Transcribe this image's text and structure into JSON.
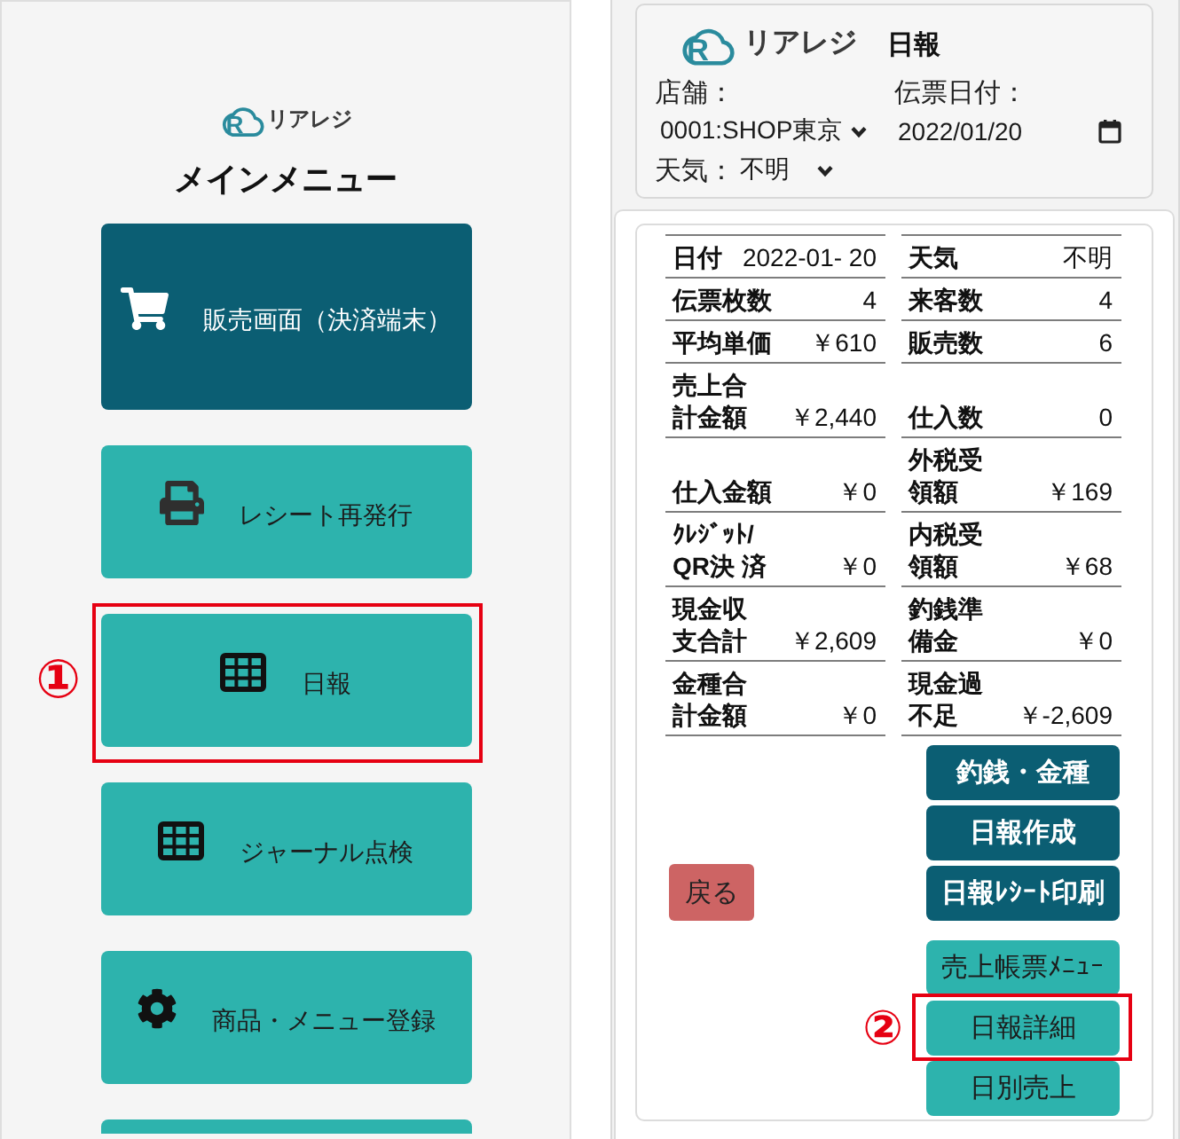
{
  "main_menu": {
    "logo": {
      "mark": "R",
      "name": "リアレジ"
    },
    "title": "メインメニュー",
    "items": [
      {
        "label": "販売画面（決済端末）",
        "kind": "primary",
        "highlighted": false
      },
      {
        "label": "レシート再発行",
        "kind": "secondary",
        "highlighted": false
      },
      {
        "label": "日報",
        "kind": "secondary",
        "highlighted": true,
        "callout": "①"
      },
      {
        "label": "ジャーナル点検",
        "kind": "secondary",
        "highlighted": false
      },
      {
        "label": "商品・メニュー登録",
        "kind": "secondary",
        "highlighted": false
      },
      {
        "kind": "secondary",
        "highlighted": false
      }
    ]
  },
  "daily_report": {
    "header": {
      "logo": {
        "mark": "R",
        "name": "リアレジ"
      },
      "title": "日報",
      "store": {
        "label": "店舗：",
        "value": "0001:SHOP東京"
      },
      "slip_date": {
        "label": "伝票日付：",
        "value": "2022/01/20"
      },
      "weather": {
        "label": "天気：",
        "value": "不明"
      }
    },
    "summary_rows": [
      {
        "left": {
          "label": "日付",
          "value": "2022-01- 20"
        },
        "right": {
          "label": "天気",
          "value": "不明"
        }
      },
      {
        "left": {
          "label": "伝票枚数",
          "value": "4"
        },
        "right": {
          "label": "来客数",
          "value": "4"
        }
      },
      {
        "left": {
          "label": "平均単価",
          "value": "￥610"
        },
        "right": {
          "label": "販売数",
          "value": "6"
        }
      },
      {
        "left": {
          "label": "売上合計金額",
          "value": "￥2,440"
        },
        "right": {
          "label": "仕入数",
          "value": "0"
        }
      },
      {
        "left": {
          "label": "仕入金額",
          "value": "￥0"
        },
        "right": {
          "label": "外税受領額",
          "value": "￥169"
        }
      },
      {
        "left": {
          "label": "ｸﾚｼﾞｯﾄ/QR決 済",
          "value": "￥0"
        },
        "right": {
          "label": "内税受領額",
          "value": "￥68"
        }
      },
      {
        "left": {
          "label": "現金収支合計",
          "value": "￥2,609"
        },
        "right": {
          "label": "釣銭準備金",
          "value": "￥0"
        }
      },
      {
        "left": {
          "label": "金種合計金額",
          "value": "￥0"
        },
        "right": {
          "label": "現金過不足",
          "value": "￥-2,609"
        }
      }
    ],
    "back_button": {
      "label": "戻る"
    },
    "action_groups": [
      [
        {
          "label": "釣銭・金種",
          "kind": "primary",
          "highlighted": false
        },
        {
          "label": "日報作成",
          "kind": "primary",
          "highlighted": false
        },
        {
          "label": "日報ﾚｼｰﾄ印刷",
          "kind": "primary",
          "highlighted": false
        }
      ],
      [
        {
          "label": "売上帳票ﾒﾆｭｰ",
          "kind": "secondary",
          "highlighted": false
        },
        {
          "label": "日報詳細",
          "kind": "secondary",
          "highlighted": true,
          "callout": "②"
        },
        {
          "label": "日別売上",
          "kind": "secondary",
          "highlighted": false
        }
      ]
    ]
  }
}
